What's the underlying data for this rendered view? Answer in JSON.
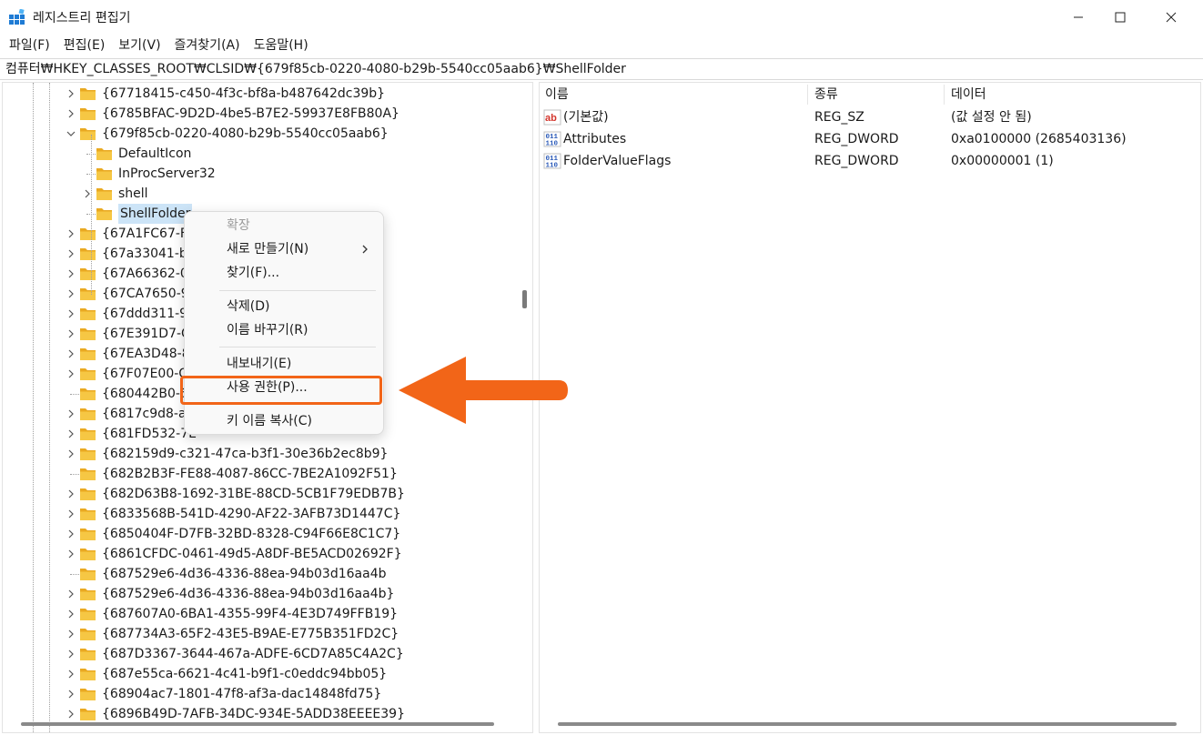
{
  "window": {
    "title": "레지스트리 편집기",
    "controls": {
      "minimize": "minimize-icon",
      "maximize": "maximize-icon",
      "close": "close-icon"
    }
  },
  "menubar": [
    "파일(F)",
    "편집(E)",
    "보기(V)",
    "즐겨찾기(A)",
    "도움말(H)"
  ],
  "address": "컴퓨터₩HKEY_CLASSES_ROOT₩CLSID₩{679f85cb-0220-4080-b29b-5540cc05aab6}₩ShellFolder",
  "tree": {
    "items": [
      {
        "label": "{67718415-c450-4f3c-bf8a-b487642dc39b}"
      },
      {
        "label": "{6785BFAC-9D2D-4be5-B7E2-59937E8FB80A}"
      },
      {
        "label": "{679f85cb-0220-4080-b29b-5540cc05aab6}"
      },
      {
        "label": "DefaultIcon"
      },
      {
        "label": "InProcServer32"
      },
      {
        "label": "shell"
      },
      {
        "label": "ShellFolder"
      },
      {
        "label": "{67A1FC67-F7"
      },
      {
        "label": "{67a33041-b8"
      },
      {
        "label": "{67A66362-05"
      },
      {
        "label": "{67CA7650-96"
      },
      {
        "label": "{67ddd311-92"
      },
      {
        "label": "{67E391D7-CF"
      },
      {
        "label": "{67EA3D48-83"
      },
      {
        "label": "{67F07E00-CC"
      },
      {
        "label": "{680442B0-6"
      },
      {
        "label": "{6817c9d8-a1"
      },
      {
        "label": "{681FD532-7E"
      },
      {
        "label": "{682159d9-c321-47ca-b3f1-30e36b2ec8b9}"
      },
      {
        "label": "{682B2B3F-FE88-4087-86CC-7BE2A1092F51}"
      },
      {
        "label": "{682D63B8-1692-31BE-88CD-5CB1F79EDB7B}"
      },
      {
        "label": "{6833568B-541D-4290-AF22-3AFB73D1447C}"
      },
      {
        "label": "{6850404F-D7FB-32BD-8328-C94F66E8C1C7}"
      },
      {
        "label": "{6861CFDC-0461-49d5-A8DF-BE5ACD02692F}"
      },
      {
        "label": "{687529e6-4d36-4336-88ea-94b03d16aa4b"
      },
      {
        "label": "{687529e6-4d36-4336-88ea-94b03d16aa4b}"
      },
      {
        "label": "{687607A0-6BA1-4355-99F4-4E3D749FFB19}"
      },
      {
        "label": "{687734A3-65F2-43E5-B9AE-E775B351FD2C}"
      },
      {
        "label": "{687D3367-3644-467a-ADFE-6CD7A85C4A2C}"
      },
      {
        "label": "{687e55ca-6621-4c41-b9f1-c0eddc94bb05}"
      },
      {
        "label": "{68904ac7-1801-47f8-af3a-dac14848fd75}"
      },
      {
        "label": "{6896B49D-7AFB-34DC-934E-5ADD38EEEE39}"
      }
    ]
  },
  "list": {
    "columns": [
      "이름",
      "종류",
      "데이터"
    ],
    "rows": [
      {
        "name": "(기본값)",
        "type": "REG_SZ",
        "data": "(값 설정 안 됨)",
        "icon": "string-value-icon"
      },
      {
        "name": "Attributes",
        "type": "REG_DWORD",
        "data": "0xa0100000 (2685403136)",
        "icon": "binary-value-icon"
      },
      {
        "name": "FolderValueFlags",
        "type": "REG_DWORD",
        "data": "0x00000001 (1)",
        "icon": "binary-value-icon"
      }
    ]
  },
  "context_menu": {
    "expand": "확장",
    "new": "새로 만들기(N)",
    "find": "찾기(F)...",
    "delete": "삭제(D)",
    "rename": "이름 바꾸기(R)",
    "export": "내보내기(E)",
    "permissions": "사용 권한(P)...",
    "copy_key_name": "키 이름 복사(C)"
  },
  "colors": {
    "highlight": "#f26518",
    "folder": "#f6c744",
    "selection": "#cce4f7"
  }
}
